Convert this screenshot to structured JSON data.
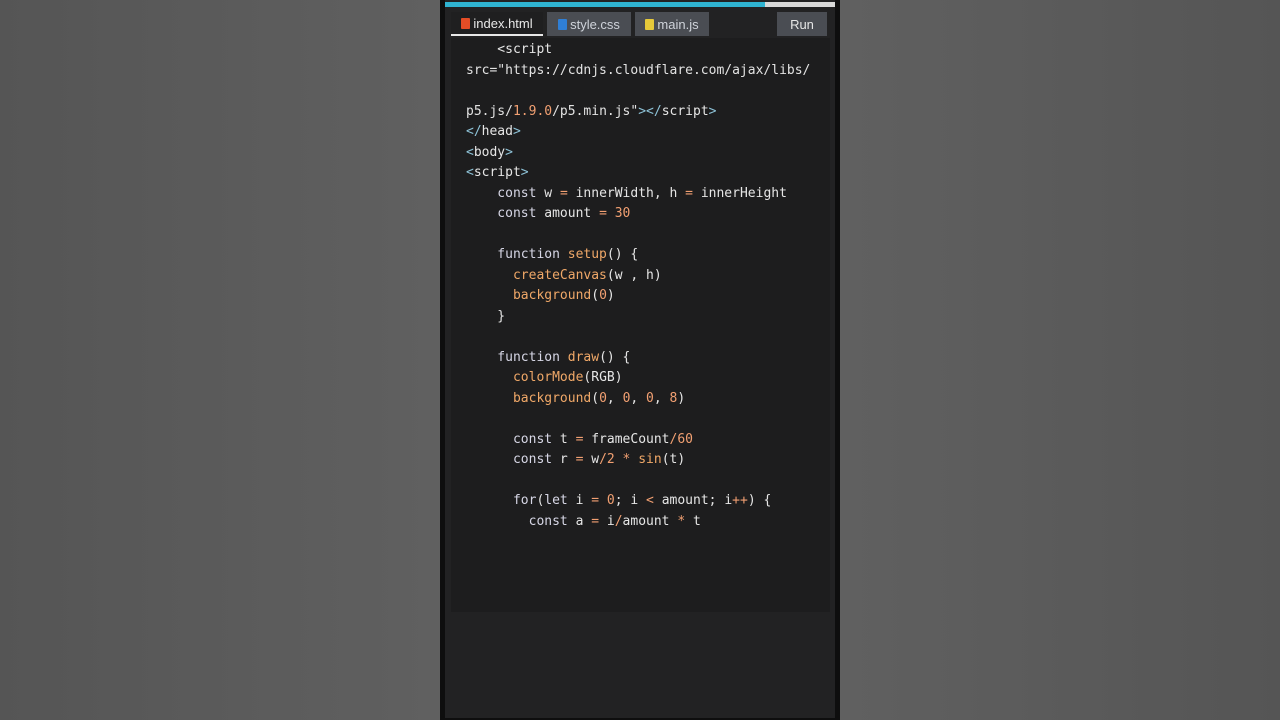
{
  "progress": 0.82,
  "tabs": [
    {
      "label": "index.html",
      "icon": "html5-icon",
      "active": true
    },
    {
      "label": "style.css",
      "icon": "css3-icon",
      "active": false
    },
    {
      "label": "main.js",
      "icon": "js-icon",
      "active": false
    }
  ],
  "run_label": "Run",
  "code_lines": [
    [
      {
        "t": "    <script",
        "c": "tag"
      }
    ],
    [
      {
        "t": "src=\"https://cdnjs.cloudflare.com/ajax/libs/",
        "c": "str"
      }
    ],
    [
      {
        "t": "",
        "c": "str"
      }
    ],
    [
      {
        "t": "p5.js/",
        "c": "str"
      },
      {
        "t": "1.9.0",
        "c": "num"
      },
      {
        "t": "/p5.min.js\"",
        "c": "str"
      },
      {
        "t": "></",
        "c": "punc"
      },
      {
        "t": "script",
        "c": "tag"
      },
      {
        "t": ">",
        "c": "punc"
      }
    ],
    [
      {
        "t": "</",
        "c": "punc"
      },
      {
        "t": "head",
        "c": "tag"
      },
      {
        "t": ">",
        "c": "punc"
      }
    ],
    [
      {
        "t": "<",
        "c": "punc"
      },
      {
        "t": "body",
        "c": "tag"
      },
      {
        "t": ">",
        "c": "punc"
      }
    ],
    [
      {
        "t": "<",
        "c": "punc"
      },
      {
        "t": "script",
        "c": "tag"
      },
      {
        "t": ">",
        "c": "punc"
      }
    ],
    [
      {
        "t": "    const ",
        "c": "kw"
      },
      {
        "t": "w ",
        "c": "tag"
      },
      {
        "t": "= ",
        "c": "op"
      },
      {
        "t": "innerWidth, h ",
        "c": "tag"
      },
      {
        "t": "= ",
        "c": "op"
      },
      {
        "t": "innerHeight",
        "c": "tag"
      }
    ],
    [
      {
        "t": "    const ",
        "c": "kw"
      },
      {
        "t": "amount ",
        "c": "tag"
      },
      {
        "t": "= ",
        "c": "op"
      },
      {
        "t": "30",
        "c": "num"
      }
    ],
    [
      {
        "t": "",
        "c": "tag"
      }
    ],
    [
      {
        "t": "    function ",
        "c": "kw"
      },
      {
        "t": "setup",
        "c": "fn"
      },
      {
        "t": "() {",
        "c": "tag"
      }
    ],
    [
      {
        "t": "      ",
        "c": "tag"
      },
      {
        "t": "createCanvas",
        "c": "fn"
      },
      {
        "t": "(w , h)",
        "c": "tag"
      }
    ],
    [
      {
        "t": "      ",
        "c": "tag"
      },
      {
        "t": "background",
        "c": "fn"
      },
      {
        "t": "(",
        "c": "tag"
      },
      {
        "t": "0",
        "c": "num"
      },
      {
        "t": ")",
        "c": "tag"
      }
    ],
    [
      {
        "t": "    }",
        "c": "tag"
      }
    ],
    [
      {
        "t": "",
        "c": "tag"
      }
    ],
    [
      {
        "t": "    function ",
        "c": "kw"
      },
      {
        "t": "draw",
        "c": "fn"
      },
      {
        "t": "() {",
        "c": "tag"
      }
    ],
    [
      {
        "t": "      ",
        "c": "tag"
      },
      {
        "t": "colorMode",
        "c": "fn"
      },
      {
        "t": "(RGB)",
        "c": "tag"
      }
    ],
    [
      {
        "t": "      ",
        "c": "tag"
      },
      {
        "t": "background",
        "c": "fn"
      },
      {
        "t": "(",
        "c": "tag"
      },
      {
        "t": "0",
        "c": "num"
      },
      {
        "t": ", ",
        "c": "tag"
      },
      {
        "t": "0",
        "c": "num"
      },
      {
        "t": ", ",
        "c": "tag"
      },
      {
        "t": "0",
        "c": "num"
      },
      {
        "t": ", ",
        "c": "tag"
      },
      {
        "t": "8",
        "c": "num"
      },
      {
        "t": ")",
        "c": "tag"
      }
    ],
    [
      {
        "t": "",
        "c": "tag"
      }
    ],
    [
      {
        "t": "      const ",
        "c": "kw"
      },
      {
        "t": "t ",
        "c": "tag"
      },
      {
        "t": "= ",
        "c": "op"
      },
      {
        "t": "frameCount",
        "c": "tag"
      },
      {
        "t": "/",
        "c": "op"
      },
      {
        "t": "60",
        "c": "num"
      }
    ],
    [
      {
        "t": "      const ",
        "c": "kw"
      },
      {
        "t": "r ",
        "c": "tag"
      },
      {
        "t": "= ",
        "c": "op"
      },
      {
        "t": "w",
        "c": "tag"
      },
      {
        "t": "/",
        "c": "op"
      },
      {
        "t": "2 ",
        "c": "num"
      },
      {
        "t": "* ",
        "c": "op"
      },
      {
        "t": "sin",
        "c": "fn"
      },
      {
        "t": "(t)",
        "c": "tag"
      }
    ],
    [
      {
        "t": "",
        "c": "tag"
      }
    ],
    [
      {
        "t": "      for",
        "c": "kw"
      },
      {
        "t": "(",
        "c": "tag"
      },
      {
        "t": "let ",
        "c": "kw"
      },
      {
        "t": "i ",
        "c": "tag"
      },
      {
        "t": "= ",
        "c": "op"
      },
      {
        "t": "0",
        "c": "num"
      },
      {
        "t": "; i ",
        "c": "tag"
      },
      {
        "t": "< ",
        "c": "op"
      },
      {
        "t": "amount; i",
        "c": "tag"
      },
      {
        "t": "++",
        "c": "op"
      },
      {
        "t": ") {",
        "c": "tag"
      }
    ],
    [
      {
        "t": "        const ",
        "c": "kw"
      },
      {
        "t": "a ",
        "c": "tag"
      },
      {
        "t": "= ",
        "c": "op"
      },
      {
        "t": "i",
        "c": "tag"
      },
      {
        "t": "/",
        "c": "op"
      },
      {
        "t": "amount ",
        "c": "tag"
      },
      {
        "t": "* ",
        "c": "op"
      },
      {
        "t": "t",
        "c": "tag"
      }
    ]
  ]
}
